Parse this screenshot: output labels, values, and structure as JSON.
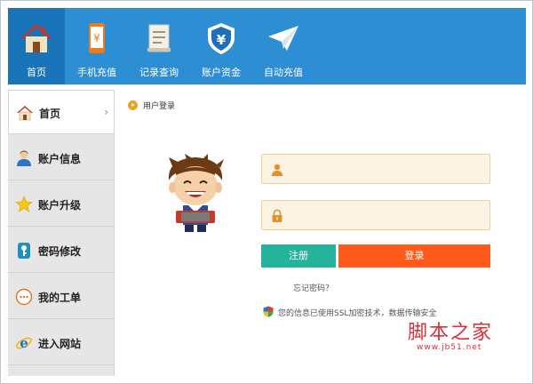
{
  "nav": {
    "items": [
      {
        "label": "首页",
        "icon": "home-icon",
        "active": true
      },
      {
        "label": "手机充值",
        "icon": "phone-recharge-icon"
      },
      {
        "label": "记录查询",
        "icon": "records-icon"
      },
      {
        "label": "账户资金",
        "icon": "account-funds-icon"
      },
      {
        "label": "自动充值",
        "icon": "paper-plane-icon"
      }
    ]
  },
  "sidebar": {
    "items": [
      {
        "label": "首页",
        "icon": "home-icon",
        "active": true
      },
      {
        "label": "账户信息",
        "icon": "user-icon"
      },
      {
        "label": "账户升级",
        "icon": "star-icon"
      },
      {
        "label": "密码修改",
        "icon": "key-icon"
      },
      {
        "label": "我的工单",
        "icon": "chat-bubble-icon"
      },
      {
        "label": "进入网站",
        "icon": "internet-explorer-icon"
      }
    ]
  },
  "breadcrumb": {
    "text": "用户登录"
  },
  "login": {
    "username_placeholder": "",
    "password_placeholder": "",
    "register_label": "注册",
    "login_label": "登录",
    "forgot_label": "忘记密码？",
    "ssl_notice": "您的信息已使用SSL加密技术，数据传输安全"
  },
  "watermark": {
    "cn": "脚本之家",
    "url": "www.jb51.net"
  },
  "colors": {
    "toolbar": "#2e8ed4",
    "toolbar_active": "#1a74b9",
    "register": "#26b39b",
    "login": "#ff5a1a",
    "field_bg": "#fdf3e3",
    "watermark": "#d8303a"
  }
}
